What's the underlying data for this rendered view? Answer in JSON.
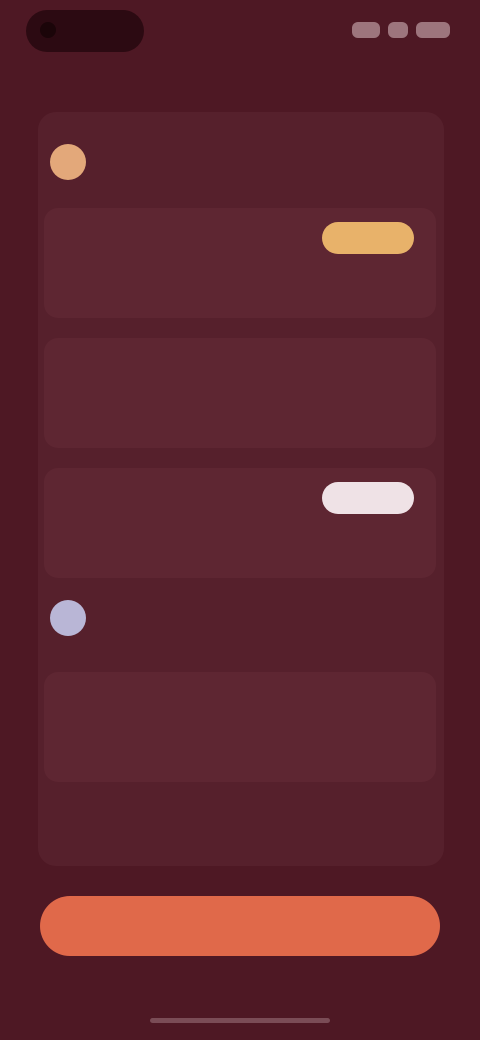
{
  "colors": {
    "background": "#4e1824",
    "accent_cta": "#e0694a",
    "accent_gold": "#e8b26a",
    "accent_light": "#efe2e6",
    "avatar_gold": "#e3a87a",
    "avatar_lilac": "#b9b6d6"
  },
  "nav": {
    "back_label": "",
    "action_label": ""
  },
  "sections": [
    {
      "avatar_icon": "user-avatar",
      "title": "",
      "subtitle": "",
      "cards": [
        {
          "title": "",
          "description": "",
          "meta": "",
          "pill_label": "",
          "pill_style": "gold"
        },
        {
          "title": "",
          "description": "",
          "meta": "",
          "pill_label": "",
          "pill_style": "none"
        },
        {
          "title": "",
          "description": "",
          "meta": "",
          "pill_label": "",
          "pill_style": "light"
        }
      ]
    },
    {
      "avatar_icon": "user-avatar",
      "title": "",
      "subtitle": "",
      "cards": [
        {
          "title": "",
          "description": "",
          "meta": "",
          "pill_label": "",
          "pill_style": "none"
        }
      ]
    }
  ],
  "cta": {
    "label": ""
  },
  "footnote": ""
}
